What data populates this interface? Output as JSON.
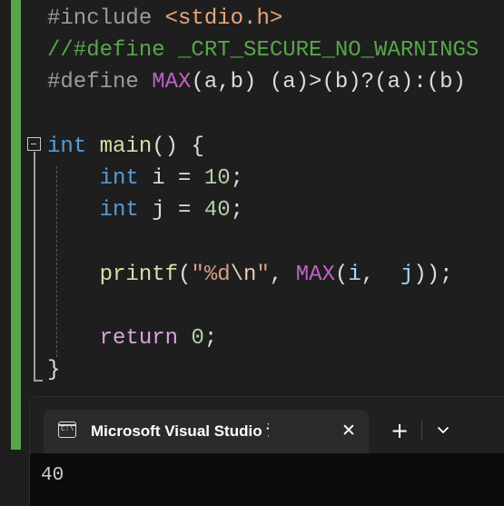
{
  "editor": {
    "code_lines": [
      {
        "tokens": [
          {
            "text": "#include ",
            "kind": "directive"
          },
          {
            "text": "<stdio.h>",
            "kind": "include-path"
          }
        ]
      },
      {
        "tokens": [
          {
            "text": "//#define _CRT_SECURE_NO_WARNINGS",
            "kind": "comment"
          }
        ]
      },
      {
        "tokens": [
          {
            "text": "#define ",
            "kind": "directive"
          },
          {
            "text": "MAX",
            "kind": "macro"
          },
          {
            "text": "(a,b) (a)>(b)?(a):(b)",
            "kind": "plain"
          }
        ]
      },
      {
        "tokens": []
      },
      {
        "tokens": [
          {
            "text": "int",
            "kind": "keyword"
          },
          {
            "text": " ",
            "kind": "plain"
          },
          {
            "text": "main",
            "kind": "func"
          },
          {
            "text": "() {",
            "kind": "plain"
          }
        ]
      },
      {
        "tokens": [
          {
            "text": "    ",
            "kind": "plain"
          },
          {
            "text": "int",
            "kind": "keyword"
          },
          {
            "text": " i = ",
            "kind": "plain"
          },
          {
            "text": "10",
            "kind": "number"
          },
          {
            "text": ";",
            "kind": "plain"
          }
        ]
      },
      {
        "tokens": [
          {
            "text": "    ",
            "kind": "plain"
          },
          {
            "text": "int",
            "kind": "keyword"
          },
          {
            "text": " j = ",
            "kind": "plain"
          },
          {
            "text": "40",
            "kind": "number"
          },
          {
            "text": ";",
            "kind": "plain"
          }
        ]
      },
      {
        "tokens": []
      },
      {
        "tokens": [
          {
            "text": "    ",
            "kind": "plain"
          },
          {
            "text": "printf",
            "kind": "func"
          },
          {
            "text": "(",
            "kind": "plain"
          },
          {
            "text": "\"%d",
            "kind": "string"
          },
          {
            "text": "\\n",
            "kind": "escape"
          },
          {
            "text": "\"",
            "kind": "string"
          },
          {
            "text": ", ",
            "kind": "plain"
          },
          {
            "text": "MAX",
            "kind": "macro"
          },
          {
            "text": "(",
            "kind": "plain"
          },
          {
            "text": "i",
            "kind": "var"
          },
          {
            "text": ",  ",
            "kind": "plain"
          },
          {
            "text": "j",
            "kind": "var"
          },
          {
            "text": "));",
            "kind": "plain"
          }
        ]
      },
      {
        "tokens": []
      },
      {
        "tokens": [
          {
            "text": "    ",
            "kind": "plain"
          },
          {
            "text": "return",
            "kind": "control"
          },
          {
            "text": " ",
            "kind": "plain"
          },
          {
            "text": "0",
            "kind": "number"
          },
          {
            "text": ";",
            "kind": "plain"
          }
        ]
      },
      {
        "tokens": [
          {
            "text": "}",
            "kind": "plain"
          }
        ]
      }
    ]
  },
  "terminal": {
    "tab_title": "Microsoft Visual Studio 调试控制台",
    "tab_icon": "console-app-icon",
    "tab_icon_glyph": "C:\\",
    "close_glyph": "✕",
    "add_glyph": "+",
    "dropdown_icon": "chevron-down-icon",
    "output": "40"
  }
}
